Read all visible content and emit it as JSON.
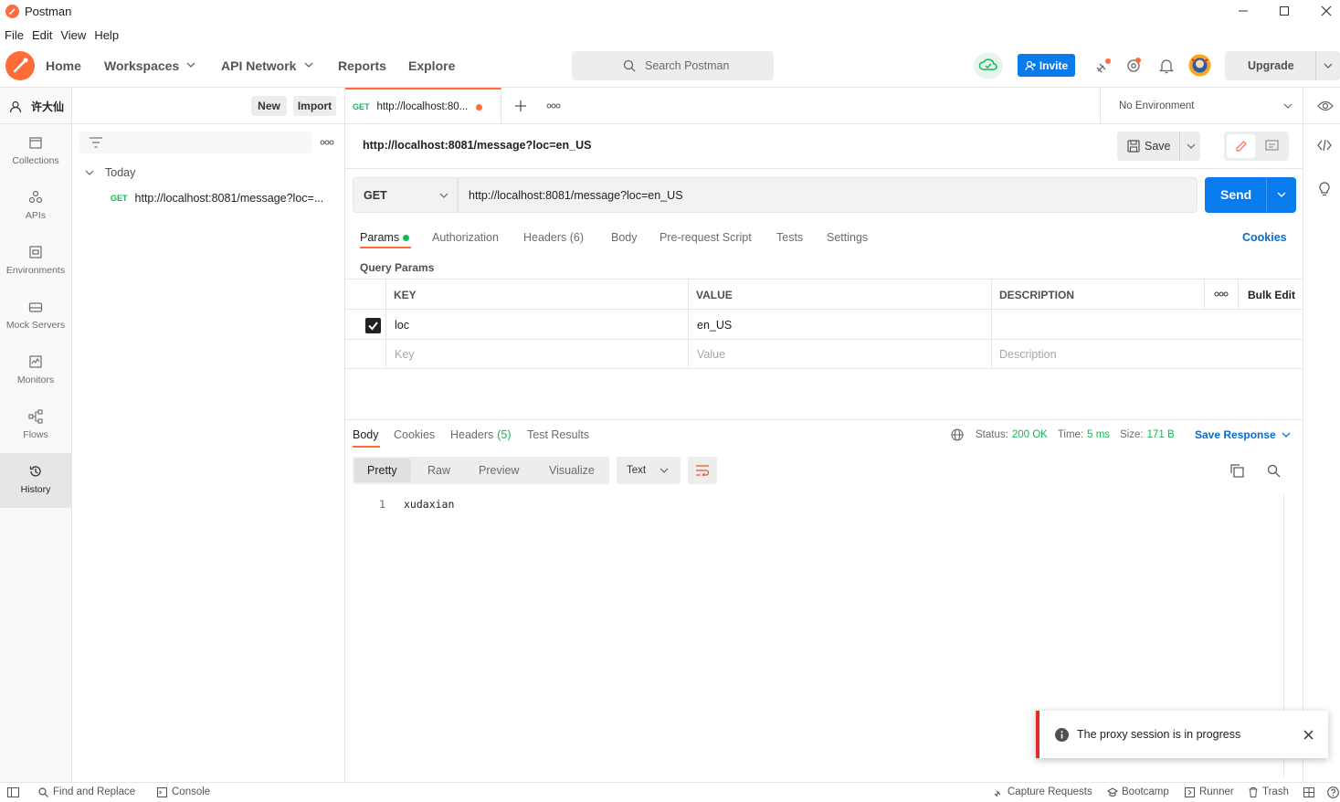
{
  "window": {
    "title": "Postman",
    "menu": [
      "File",
      "Edit",
      "View",
      "Help"
    ]
  },
  "header": {
    "nav": [
      "Home",
      "Workspaces",
      "API Network",
      "Reports",
      "Explore"
    ],
    "search_placeholder": "Search Postman",
    "invite_label": "Invite",
    "upgrade_label": "Upgrade"
  },
  "sidebar": {
    "user": "许大仙",
    "new_label": "New",
    "import_label": "Import",
    "items": [
      {
        "label": "Collections",
        "icon": "collections-icon"
      },
      {
        "label": "APIs",
        "icon": "apis-icon"
      },
      {
        "label": "Environments",
        "icon": "environments-icon"
      },
      {
        "label": "Mock Servers",
        "icon": "mock-servers-icon"
      },
      {
        "label": "Monitors",
        "icon": "monitors-icon"
      },
      {
        "label": "Flows",
        "icon": "flows-icon"
      },
      {
        "label": "History",
        "icon": "history-icon"
      }
    ]
  },
  "history": {
    "group": "Today",
    "entries": [
      {
        "method": "GET",
        "url": "http://localhost:8081/message?loc=..."
      }
    ]
  },
  "tabs": {
    "open": [
      {
        "method": "GET",
        "title": "http://localhost:80..."
      }
    ],
    "environment": "No Environment"
  },
  "request": {
    "name": "http://localhost:8081/message?loc=en_US",
    "save_label": "Save",
    "method": "GET",
    "url": "http://localhost:8081/message?loc=en_US",
    "send_label": "Send",
    "tabs": [
      "Params",
      "Authorization",
      "Headers (6)",
      "Body",
      "Pre-request Script",
      "Tests",
      "Settings"
    ],
    "cookies_label": "Cookies",
    "query_params_title": "Query Params",
    "columns": [
      "KEY",
      "VALUE",
      "DESCRIPTION"
    ],
    "bulk_edit_label": "Bulk Edit",
    "params": [
      {
        "key": "loc",
        "value": "en_US",
        "description": "",
        "checked": true
      }
    ],
    "placeholder_row": {
      "key": "Key",
      "value": "Value",
      "description": "Description"
    }
  },
  "response": {
    "tabs": [
      "Body",
      "Cookies",
      "Headers",
      "Test Results"
    ],
    "headers_count": "(5)",
    "status_label": "Status:",
    "status_value": "200 OK",
    "time_label": "Time:",
    "time_value": "5 ms",
    "size_label": "Size:",
    "size_value": "171 B",
    "save_response_label": "Save Response",
    "view_modes": [
      "Pretty",
      "Raw",
      "Preview",
      "Visualize"
    ],
    "format": "Text",
    "lines": [
      {
        "num": "1",
        "text": "xudaxian"
      }
    ]
  },
  "toast": {
    "message": "The proxy session is in progress"
  },
  "footer": {
    "left": [
      "Find and Replace",
      "Console"
    ],
    "right": [
      "Capture Requests",
      "Bootcamp",
      "Runner",
      "Trash"
    ]
  },
  "colors": {
    "brand": "#ff6c37",
    "accent_blue": "#097bed",
    "status_green": "#0cbb52",
    "toast_red": "#e02c2c"
  }
}
